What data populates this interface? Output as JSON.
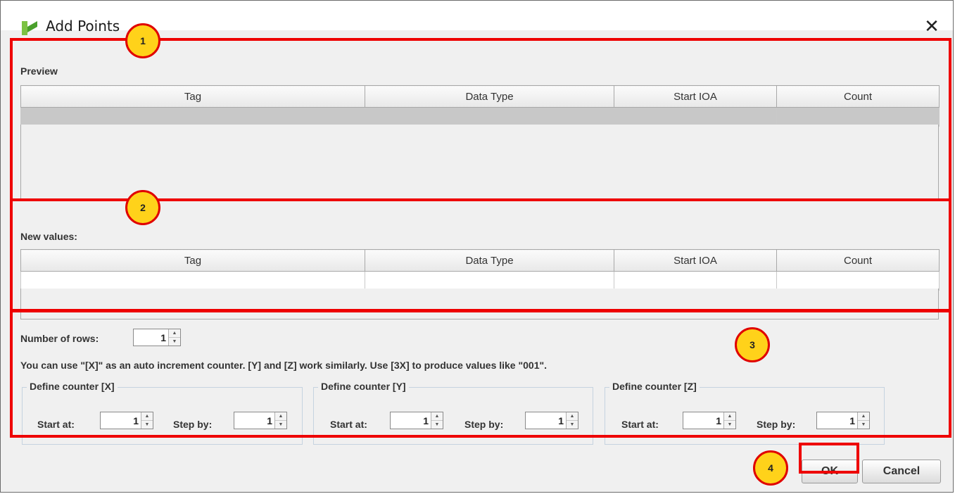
{
  "window": {
    "title": "Add Points",
    "close_glyph": "✕"
  },
  "preview": {
    "label": "Preview",
    "columns": [
      "Tag",
      "Data Type",
      "Start IOA",
      "Count"
    ]
  },
  "new_values": {
    "label": "New values:",
    "columns": [
      "Tag",
      "Data Type",
      "Start IOA",
      "Count"
    ]
  },
  "settings": {
    "rows_label": "Number of rows:",
    "rows_value": "1",
    "hint": "You can use \"[X]\" as an auto increment counter. [Y] and [Z] work similarly. Use [3X] to produce values like \"001\".",
    "counters": [
      {
        "legend": "Define counter [X]",
        "start_label": "Start at:",
        "start_value": "1",
        "step_label": "Step by:",
        "step_value": "1"
      },
      {
        "legend": "Define counter [Y]",
        "start_label": "Start at:",
        "start_value": "1",
        "step_label": "Step by:",
        "step_value": "1"
      },
      {
        "legend": "Define counter [Z]",
        "start_label": "Start at:",
        "start_value": "1",
        "step_label": "Step by:",
        "step_value": "1"
      }
    ]
  },
  "buttons": {
    "ok": "OK",
    "cancel": "Cancel"
  },
  "callouts": [
    "1",
    "2",
    "3",
    "4"
  ],
  "colors": {
    "callout_red": "#ee0000",
    "badge_yellow": "#ffd21a"
  },
  "icons": {
    "app": "app-logo-icon",
    "close": "close-icon",
    "up": "spinner-up-icon",
    "down": "spinner-down-icon"
  }
}
